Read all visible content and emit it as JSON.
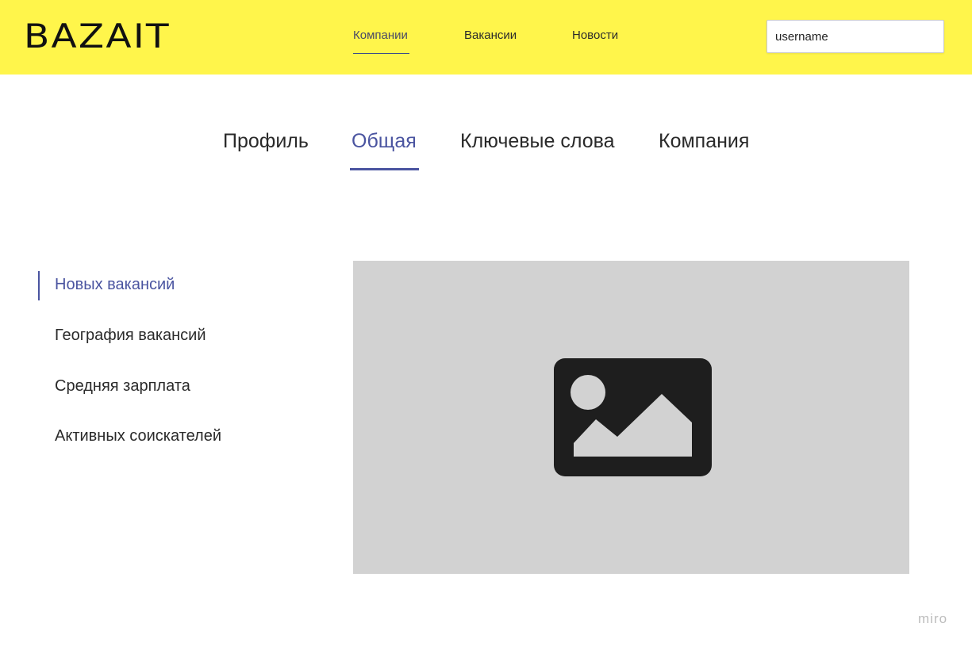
{
  "header": {
    "logo_text": "BAZAIT",
    "background_color": "#fff54b",
    "nav": [
      {
        "label": "Компании",
        "active": true
      },
      {
        "label": "Вакансии",
        "active": false
      },
      {
        "label": "Новости",
        "active": false
      }
    ],
    "user": {
      "value": "username"
    }
  },
  "tabs": [
    {
      "label": "Профиль",
      "active": false
    },
    {
      "label": "Общая",
      "active": true
    },
    {
      "label": "Ключевые слова",
      "active": false
    },
    {
      "label": "Компания",
      "active": false
    }
  ],
  "sidebar": {
    "items": [
      {
        "label": "Новых вакансий",
        "active": true
      },
      {
        "label": "География вакансий",
        "active": false
      },
      {
        "label": "Средняя зарплата",
        "active": false
      },
      {
        "label": "Активных соискателей",
        "active": false
      }
    ]
  },
  "main": {
    "placeholder_icon": "image-icon"
  },
  "watermark": "miro",
  "colors": {
    "accent": "#4a54a0",
    "placeholder_bg": "#d2d2d2",
    "icon": "#1e1e1e"
  }
}
